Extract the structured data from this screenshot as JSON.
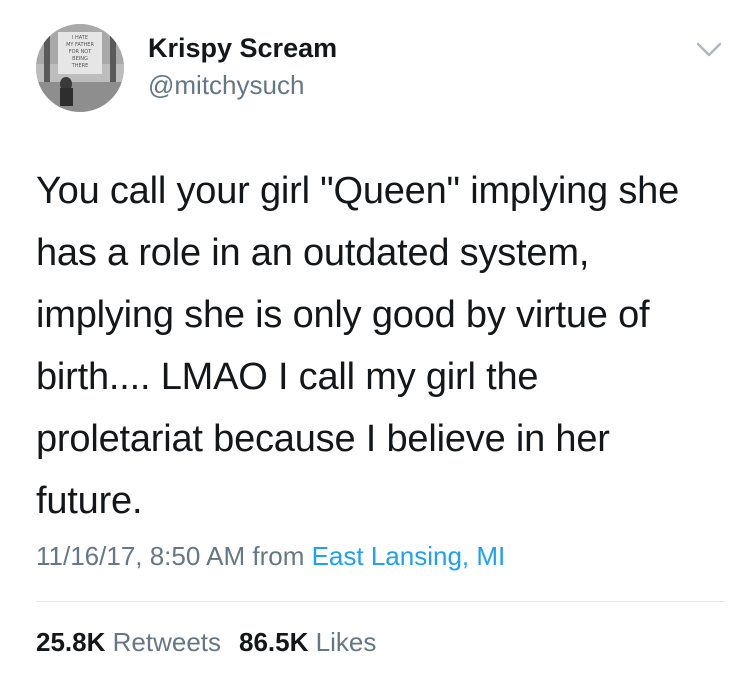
{
  "author": {
    "display_name": "Krispy Scream",
    "handle": "@mitchysuch",
    "avatar_sign_lines": [
      "I HATE",
      "MY FATHER",
      "FOR NOT",
      "BEING",
      "THERE"
    ]
  },
  "tweet": {
    "lines": [
      "You call your girl \"Queen\" implying she",
      "has a role in an outdated system,",
      "implying she is only good by virtue of",
      "birth.... LMAO I call my girl the",
      "proletariat because I believe in her",
      "future."
    ]
  },
  "meta": {
    "timestamp": "11/16/17, 8:50 AM",
    "from_label": "from",
    "location": "East Lansing, MI"
  },
  "stats": {
    "retweets_count": "25.8K",
    "retweets_label": "Retweets",
    "likes_count": "86.5K",
    "likes_label": "Likes"
  },
  "colors": {
    "text": "#14171a",
    "secondary": "#657786",
    "link": "#1da1f2",
    "divider": "#e1e8ed"
  },
  "icons": {
    "menu": "chevron-down-icon"
  }
}
